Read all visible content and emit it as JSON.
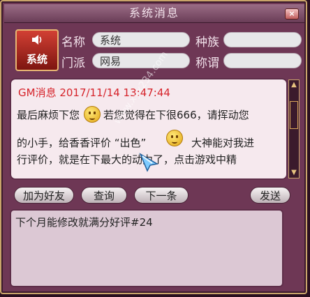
{
  "window": {
    "title": "系统消息",
    "close_label": "×"
  },
  "profile": {
    "emblem_label": "系统",
    "fields": {
      "name_label": "名称",
      "name_value": "系统",
      "race_label": "种族",
      "race_value": "",
      "faction_label": "门派",
      "faction_value": "网易",
      "title_label": "称谓",
      "title_value": ""
    }
  },
  "message": {
    "header": "GM消息 2017/11/14 13:47:44",
    "line1_a": "最后麻烦下您",
    "line1_b": "若您觉得在下很666，请挥动您",
    "line2_a": "的小手，给香香评价 “出色”",
    "line2_b": "大神能对我进",
    "line3": "行评价，就是在下最大的动力了，点击游戏中精",
    "watermark": "www.xyx234.com"
  },
  "actions": {
    "add_friend": "加为好友",
    "query": "查询",
    "next": "下一条",
    "send": "发送"
  },
  "input": {
    "value": "下个月能修改就满分好评#24"
  },
  "colors": {
    "accent_red": "#d6242b",
    "frame_gold": "#c9a46a",
    "bg_plum": "#6e3755"
  }
}
